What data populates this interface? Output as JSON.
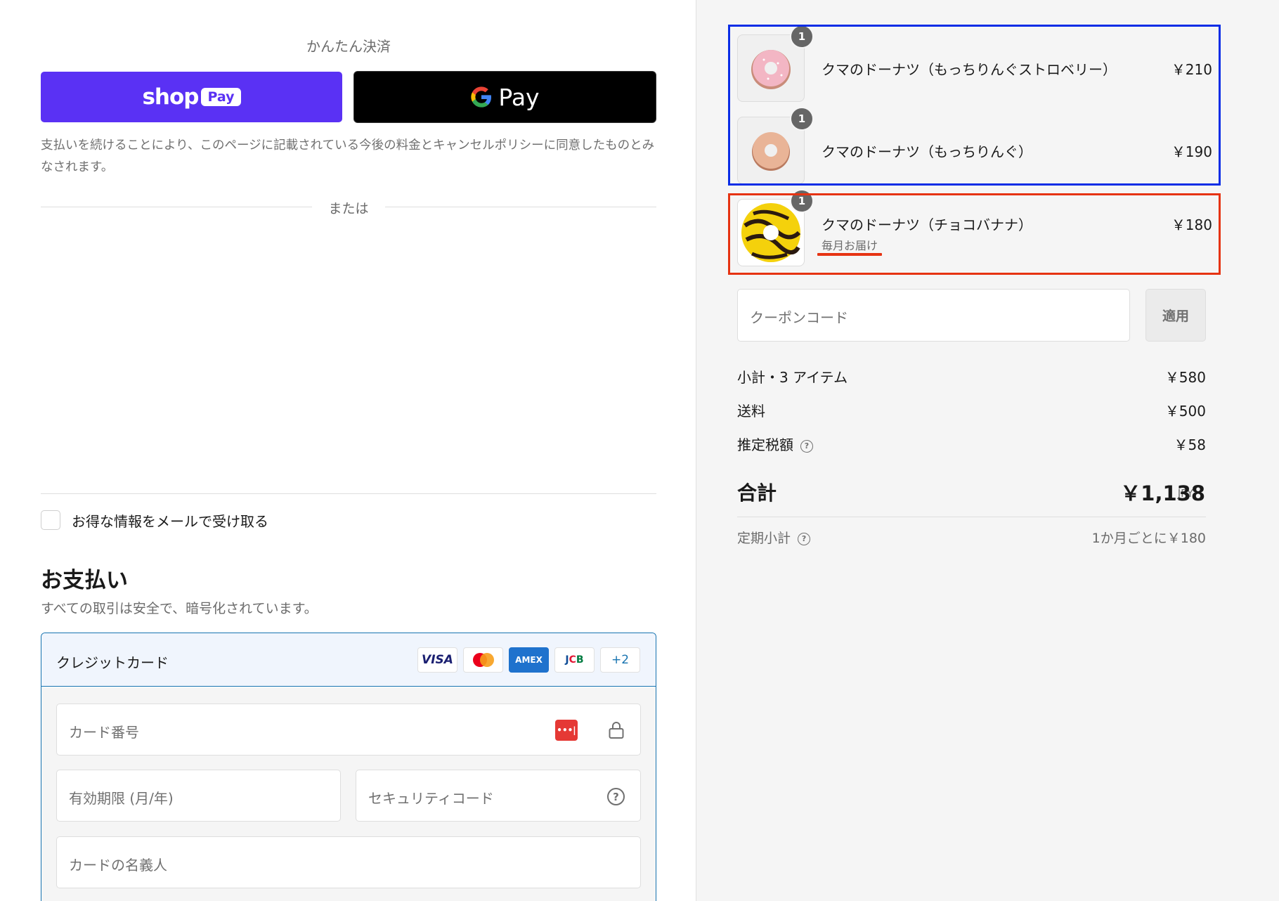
{
  "express": {
    "title": "かんたん決済",
    "shop_pay": {
      "word": "shop",
      "pill": "Pay"
    },
    "google_pay": {
      "word": "Pay"
    },
    "consent": "支払いを続けることにより、このページに記載されている今後の料金とキャンセルポリシーに同意したものとみなされます。",
    "or": "または"
  },
  "marketing": {
    "label": "お得な情報をメールで受け取る",
    "checked": false
  },
  "payment": {
    "heading": "お支払い",
    "subtitle": "すべての取引は安全で、暗号化されています。",
    "method": {
      "title": "クレジットカード",
      "logos": [
        "VISA",
        "mastercard",
        "AMEX",
        "JCB"
      ],
      "more": "+2"
    },
    "fields": {
      "card_number": "カード番号",
      "expiry": "有効期限 (月/年)",
      "security": "セキュリティコード",
      "name": "カードの名義人"
    }
  },
  "cart": {
    "items": [
      {
        "name": "クマのドーナツ（もっちりんぐストロベリー）",
        "price": "￥210",
        "qty": "1",
        "image": "pink-donut"
      },
      {
        "name": "クマのドーナツ（もっちりんぐ）",
        "price": "￥190",
        "qty": "1",
        "image": "plain-donut"
      },
      {
        "name": "クマのドーナツ（チョコバナナ）",
        "price": "￥180",
        "qty": "1",
        "subtitle": "毎月お届け",
        "image": "choco-banana-donut"
      }
    ],
    "coupon_placeholder": "クーポンコード",
    "apply": "適用",
    "subtotal_label": "小計・3 アイテム",
    "subtotal": "￥580",
    "shipping_label": "送料",
    "shipping": "￥500",
    "tax_label": "推定税額",
    "tax": "￥58",
    "total_label": "合計",
    "currency": "JPY",
    "total": "￥1,138",
    "recurring_label": "定期小計",
    "recurring": "1か月ごとに￥180"
  },
  "colors": {
    "shop_pay": "#5a31f4",
    "highlight_blue": "#0a2de6",
    "highlight_red": "#e63312",
    "accent": "#1773b0"
  }
}
